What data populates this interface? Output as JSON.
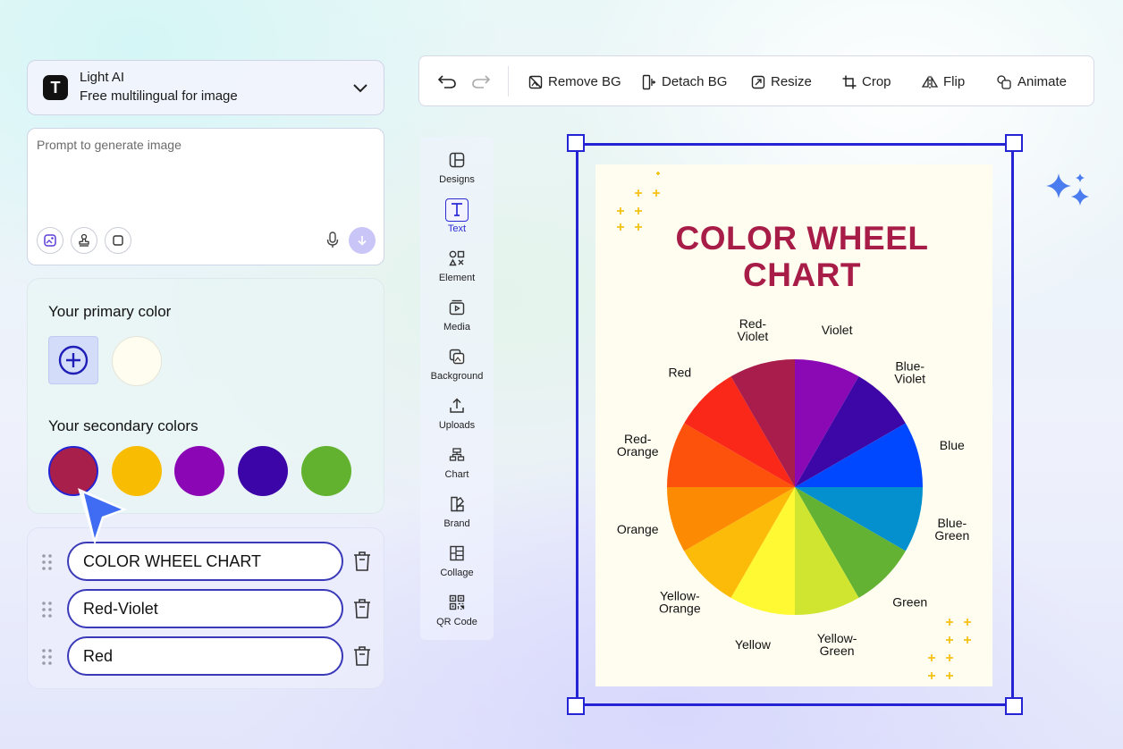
{
  "model": {
    "name": "Light AI",
    "description": "Free multilingual for image",
    "logo_letter": "T"
  },
  "prompt": {
    "placeholder": "Prompt to generate image",
    "value": ""
  },
  "colors": {
    "primary_heading": "Your primary color",
    "secondary_heading": "Your secondary colors",
    "primary": "#fffdf0",
    "secondary": [
      "#a91f4b",
      "#f8bd03",
      "#8b06b4",
      "#3c05a8",
      "#62b230"
    ]
  },
  "layers": [
    {
      "value": "COLOR WHEEL CHART"
    },
    {
      "value": "Red-Violet"
    },
    {
      "value": "Red"
    }
  ],
  "toolbar": {
    "remove_bg": "Remove BG",
    "detach_bg": "Detach BG",
    "resize": "Resize",
    "crop": "Crop",
    "flip": "Flip",
    "animate": "Animate"
  },
  "sidebar": {
    "items": [
      {
        "label": "Designs",
        "icon": "layout-icon"
      },
      {
        "label": "Text",
        "icon": "text-icon"
      },
      {
        "label": "Element",
        "icon": "shapes-icon"
      },
      {
        "label": "Media",
        "icon": "media-icon"
      },
      {
        "label": "Background",
        "icon": "background-icon"
      },
      {
        "label": "Uploads",
        "icon": "upload-icon"
      },
      {
        "label": "Chart",
        "icon": "chart-icon"
      },
      {
        "label": "Brand",
        "icon": "brand-icon"
      },
      {
        "label": "Collage",
        "icon": "collage-icon"
      },
      {
        "label": "QR Code",
        "icon": "qr-code-icon"
      }
    ],
    "active": "Text"
  },
  "poster": {
    "title_line1": "COLOR WHEEL",
    "title_line2": "CHART",
    "title_color": "#a81d48",
    "segments": [
      {
        "line1": "Violet",
        "line2": "",
        "color": "#8a09b5"
      },
      {
        "line1": "Blue-",
        "line2": "Violet",
        "color": "#3d06a6"
      },
      {
        "line1": "Blue",
        "line2": "",
        "color": "#0048ff"
      },
      {
        "line1": "Blue-",
        "line2": "Green",
        "color": "#0490cf"
      },
      {
        "line1": "Green",
        "line2": "",
        "color": "#63b233"
      },
      {
        "line1": "Yellow-",
        "line2": "Green",
        "color": "#cfe530"
      },
      {
        "line1": "Yellow",
        "line2": "",
        "color": "#fef932"
      },
      {
        "line1": "Yellow-",
        "line2": "Orange",
        "color": "#fbbb08"
      },
      {
        "line1": "Orange",
        "line2": "",
        "color": "#fd8a03"
      },
      {
        "line1": "Red-",
        "line2": "Orange",
        "color": "#fd520b"
      },
      {
        "line1": "Red",
        "line2": "",
        "color": "#f92819"
      },
      {
        "line1": "Red-",
        "line2": "Violet",
        "color": "#a81d4b"
      }
    ]
  }
}
